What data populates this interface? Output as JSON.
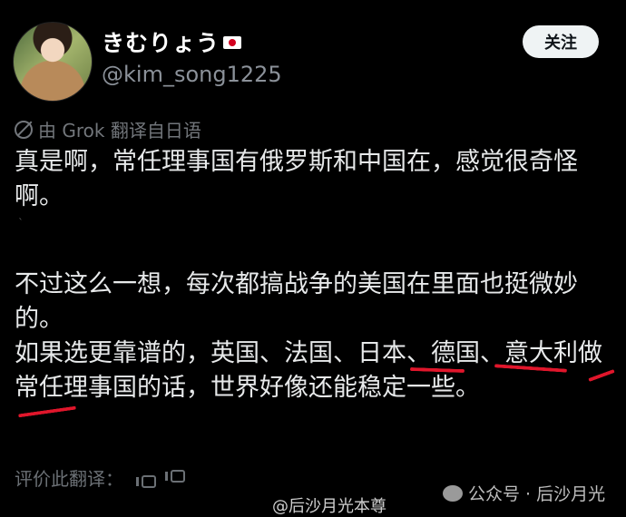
{
  "profile": {
    "display_name": "きむりょう",
    "handle": "@kim_song1225",
    "follow_label": "关注"
  },
  "translation_note": "由 Grok 翻译自日语",
  "tweet": {
    "paragraph1": "真是啊，常任理事国有俄罗斯和中国在，感觉很奇怪啊。",
    "dot": "`",
    "paragraph2": "不过这么一想，每次都搞战争的美国在里面也挺微妙的。",
    "paragraph3": "如果选更靠谱的，英国、法国、日本、德国、意大利做常任理事国的话，世界好像还能稳定一些。"
  },
  "footer": {
    "rate_label": "评价此翻译：",
    "weibo_watermark": "@后沙月光本尊",
    "wechat_watermark": "公众号 · 后沙月光"
  },
  "colors": {
    "background": "#000000",
    "underline": "#e0162b",
    "follow_button": "#eff3f4"
  }
}
